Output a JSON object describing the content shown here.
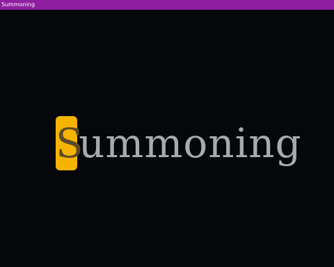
{
  "window": {
    "title": "Summoning"
  },
  "game": {
    "word_first_letter": "S",
    "word_rest": "ummoning",
    "colors": {
      "background": "#05070b",
      "title_bar": "#8e1f9e",
      "highlight": "#f5b400",
      "typed_letter": "#5a4a2a",
      "pending_letters": "#a7aaae"
    }
  }
}
